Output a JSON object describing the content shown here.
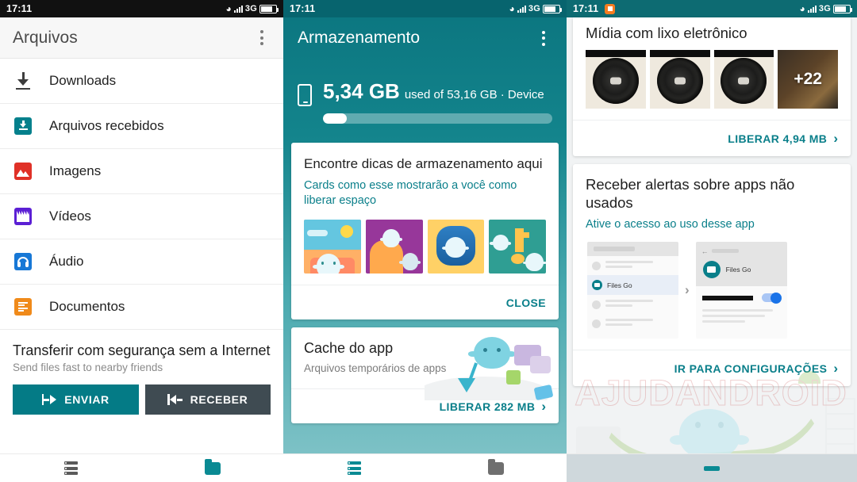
{
  "statusbars": {
    "time": "17:11",
    "network": "3G",
    "wifi_icon": "wifi-icon",
    "signal_icon": "signal-bars-icon",
    "battery_icon": "battery-icon",
    "notification_icon": "notification-dot-icon"
  },
  "left_panel": {
    "appbar": {
      "title": "Arquivos",
      "overflow_icon": "kebab-menu-icon"
    },
    "items": [
      {
        "label": "Downloads",
        "icon": "download-icon",
        "color": "#3d3d3d"
      },
      {
        "label": "Arquivos recebidos",
        "icon": "inbox-download-icon",
        "color": "#04808c"
      },
      {
        "label": "Imagens",
        "icon": "image-icon",
        "color": "#e03127"
      },
      {
        "label": "Vídeos",
        "icon": "video-clapper-icon",
        "color": "#5b1fd4"
      },
      {
        "label": "Áudio",
        "icon": "headphones-icon",
        "color": "#1778d6"
      },
      {
        "label": "Documentos",
        "icon": "document-lines-icon",
        "color": "#f08a1a"
      }
    ],
    "transfer": {
      "title": "Transferir com segurança sem a Internet",
      "subtitle": "Send files fast to nearby friends",
      "send_button": "ENVIAR",
      "receive_button": "RECEBER",
      "send_icon": "send-arrow-icon",
      "receive_icon": "receive-arrow-icon",
      "send_color": "#047b86",
      "receive_color": "#3f4b52"
    }
  },
  "middle_panel": {
    "appbar": {
      "title": "Armazenamento",
      "overflow_icon": "kebab-menu-icon"
    },
    "storage": {
      "device_icon": "phone-icon",
      "used": "5,34 GB",
      "detail": "used of 53,16 GB · Device",
      "percent_used": 10.5
    },
    "tips_card": {
      "title": "Encontre dicas de armazenamento aqui",
      "subtitle": "Cards como esse mostrarão a você como liberar espaço",
      "thumbnails": [
        "beach-blob-illustration",
        "couch-blob-illustration",
        "app-icon-blob-illustration",
        "music-blob-illustration"
      ],
      "close_label": "CLOSE"
    },
    "cache_card": {
      "title": "Cache do app",
      "subtitle": "Arquivos temporários de apps",
      "action_label": "LIBERAR 282 MB",
      "chevron": "›"
    }
  },
  "right_panel": {
    "media_card": {
      "title": "Mídia com lixo eletrônico",
      "thumbnails": [
        "fan-photo",
        "fan-photo",
        "fan-photo",
        "more-photos"
      ],
      "more_count": "+22",
      "action_label": "LIBERAR 4,94 MB",
      "chevron": "›"
    },
    "alerts_card": {
      "title": "Receber alertas sobre apps não usados",
      "subtitle": "Ative o acesso ao uso desse app",
      "preview_app_name": "Files Go",
      "preview_arrow": "›",
      "action_label": "IR PARA CONFIGURAÇÕES",
      "chevron": "›"
    },
    "watermark": {
      "text": "AJUDANDROID"
    }
  },
  "bottom_nav": {
    "items": [
      {
        "icon": "list-icon",
        "color": "#5a5a5a",
        "active": false
      },
      {
        "icon": "folder-icon",
        "color": "#0a8a93",
        "active": true
      },
      {
        "icon": "list-icon",
        "color": "#0a8a93",
        "active": true
      },
      {
        "icon": "folder-icon",
        "color": "#6f6f6f",
        "active": false
      },
      {
        "icon": "tab-indicator-icon",
        "color": "#0a8a93",
        "active": true
      }
    ]
  },
  "colors": {
    "teal_primary": "#0a7f8a",
    "teal_dark": "#07646e",
    "accent_orange": "#f08a1a",
    "card_bg": "#ffffff",
    "page_bg": "#f1f3f4"
  }
}
